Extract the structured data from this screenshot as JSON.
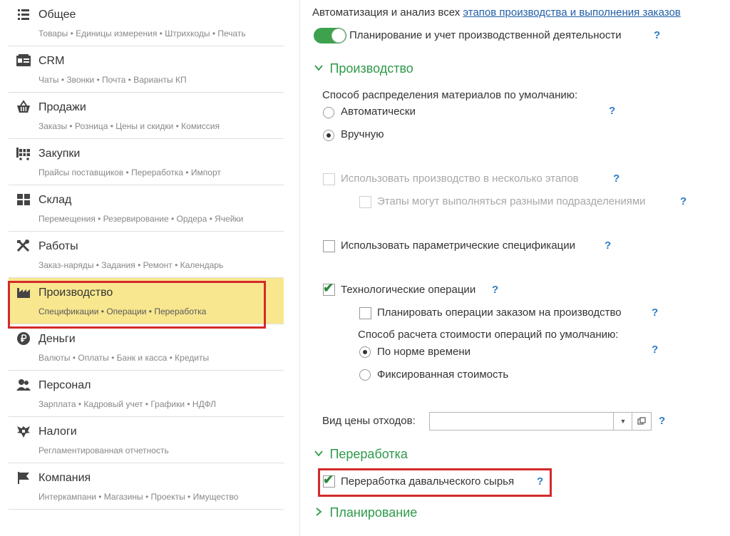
{
  "sidebar": {
    "items": [
      {
        "title": "Общее",
        "subtitle": "Товары • Единицы измерения • Штрихкоды • Печать",
        "icon": "list-icon"
      },
      {
        "title": "CRM",
        "subtitle": "Чаты • Звонки • Почта • Варианты КП",
        "icon": "contact-card-icon"
      },
      {
        "title": "Продажи",
        "subtitle": "Заказы • Розница • Цены и скидки • Комиссия",
        "icon": "basket-icon"
      },
      {
        "title": "Закупки",
        "subtitle": "Прайсы поставщиков • Переработка • Импорт",
        "icon": "cart-icon"
      },
      {
        "title": "Склад",
        "subtitle": "Перемещения • Резервирование • Ордера • Ячейки",
        "icon": "warehouse-grid-icon"
      },
      {
        "title": "Работы",
        "subtitle": "Заказ-наряды • Задания • Ремонт • Календарь",
        "icon": "tools-icon"
      },
      {
        "title": "Производство",
        "subtitle": "Спецификации • Операции • Переработка",
        "icon": "factory-icon",
        "active": true
      },
      {
        "title": "Деньги",
        "subtitle": "Валюты • Оплаты • Банк и касса • Кредиты",
        "icon": "ruble-coin-icon"
      },
      {
        "title": "Персонал",
        "subtitle": "Зарплата • Кадровый учет • Графики • НДФЛ",
        "icon": "people-icon"
      },
      {
        "title": "Налоги",
        "subtitle": "Регламентированная отчетность",
        "icon": "eagle-emblem-icon"
      },
      {
        "title": "Компания",
        "subtitle": "Интеркампани • Магазины • Проекты • Имущество",
        "icon": "flag-icon"
      }
    ]
  },
  "main": {
    "intro_text": "Автоматизация и анализ всех",
    "intro_link": "этапов производства и выполнения заказов",
    "toggle_label": "Планирование и учет производственной деятельности",
    "toggle_on": true,
    "help": "?",
    "production_header": "Производство",
    "distribution_label": "Способ распределения материалов по умолчанию:",
    "radio_auto": "Автоматически",
    "radio_manual": "Вручную",
    "multi_stage": "Использовать производство в несколько этапов",
    "stages_divisions": "Этапы могут выполняться разными подразделениями",
    "param_specs": "Использовать параметрические спецификации",
    "tech_ops": "Технологические операции",
    "plan_ops_by_order": "Планировать операции заказом на производство",
    "cost_method_label": "Способ расчета стоимости операций по умолчанию:",
    "radio_norm_time": "По норме времени",
    "radio_fixed_cost": "Фиксированная стоимость",
    "waste_price_label": "Вид цены отходов:",
    "waste_price_value": "",
    "processing_header": "Переработка",
    "tolling_raw": "Переработка давальческого сырья",
    "planning_header": "Планирование"
  },
  "colors": {
    "accent_green": "#2e9a4a",
    "active_bg": "#f8e78f",
    "highlight_red": "#d42a2a",
    "link_blue": "#1f5fa8"
  }
}
